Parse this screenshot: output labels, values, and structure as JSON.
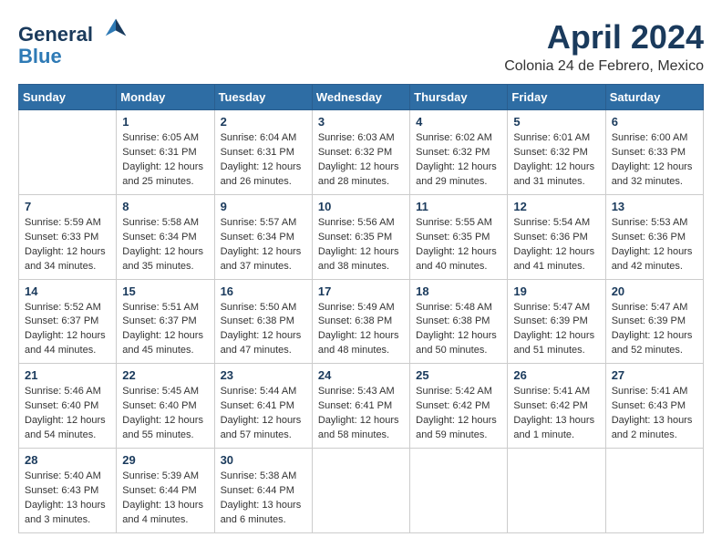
{
  "header": {
    "logo_line1": "General",
    "logo_line2": "Blue",
    "month_title": "April 2024",
    "subtitle": "Colonia 24 de Febrero, Mexico"
  },
  "weekdays": [
    "Sunday",
    "Monday",
    "Tuesday",
    "Wednesday",
    "Thursday",
    "Friday",
    "Saturday"
  ],
  "weeks": [
    [
      {
        "day": "",
        "info": ""
      },
      {
        "day": "1",
        "info": "Sunrise: 6:05 AM\nSunset: 6:31 PM\nDaylight: 12 hours\nand 25 minutes."
      },
      {
        "day": "2",
        "info": "Sunrise: 6:04 AM\nSunset: 6:31 PM\nDaylight: 12 hours\nand 26 minutes."
      },
      {
        "day": "3",
        "info": "Sunrise: 6:03 AM\nSunset: 6:32 PM\nDaylight: 12 hours\nand 28 minutes."
      },
      {
        "day": "4",
        "info": "Sunrise: 6:02 AM\nSunset: 6:32 PM\nDaylight: 12 hours\nand 29 minutes."
      },
      {
        "day": "5",
        "info": "Sunrise: 6:01 AM\nSunset: 6:32 PM\nDaylight: 12 hours\nand 31 minutes."
      },
      {
        "day": "6",
        "info": "Sunrise: 6:00 AM\nSunset: 6:33 PM\nDaylight: 12 hours\nand 32 minutes."
      }
    ],
    [
      {
        "day": "7",
        "info": "Sunrise: 5:59 AM\nSunset: 6:33 PM\nDaylight: 12 hours\nand 34 minutes."
      },
      {
        "day": "8",
        "info": "Sunrise: 5:58 AM\nSunset: 6:34 PM\nDaylight: 12 hours\nand 35 minutes."
      },
      {
        "day": "9",
        "info": "Sunrise: 5:57 AM\nSunset: 6:34 PM\nDaylight: 12 hours\nand 37 minutes."
      },
      {
        "day": "10",
        "info": "Sunrise: 5:56 AM\nSunset: 6:35 PM\nDaylight: 12 hours\nand 38 minutes."
      },
      {
        "day": "11",
        "info": "Sunrise: 5:55 AM\nSunset: 6:35 PM\nDaylight: 12 hours\nand 40 minutes."
      },
      {
        "day": "12",
        "info": "Sunrise: 5:54 AM\nSunset: 6:36 PM\nDaylight: 12 hours\nand 41 minutes."
      },
      {
        "day": "13",
        "info": "Sunrise: 5:53 AM\nSunset: 6:36 PM\nDaylight: 12 hours\nand 42 minutes."
      }
    ],
    [
      {
        "day": "14",
        "info": "Sunrise: 5:52 AM\nSunset: 6:37 PM\nDaylight: 12 hours\nand 44 minutes."
      },
      {
        "day": "15",
        "info": "Sunrise: 5:51 AM\nSunset: 6:37 PM\nDaylight: 12 hours\nand 45 minutes."
      },
      {
        "day": "16",
        "info": "Sunrise: 5:50 AM\nSunset: 6:38 PM\nDaylight: 12 hours\nand 47 minutes."
      },
      {
        "day": "17",
        "info": "Sunrise: 5:49 AM\nSunset: 6:38 PM\nDaylight: 12 hours\nand 48 minutes."
      },
      {
        "day": "18",
        "info": "Sunrise: 5:48 AM\nSunset: 6:38 PM\nDaylight: 12 hours\nand 50 minutes."
      },
      {
        "day": "19",
        "info": "Sunrise: 5:47 AM\nSunset: 6:39 PM\nDaylight: 12 hours\nand 51 minutes."
      },
      {
        "day": "20",
        "info": "Sunrise: 5:47 AM\nSunset: 6:39 PM\nDaylight: 12 hours\nand 52 minutes."
      }
    ],
    [
      {
        "day": "21",
        "info": "Sunrise: 5:46 AM\nSunset: 6:40 PM\nDaylight: 12 hours\nand 54 minutes."
      },
      {
        "day": "22",
        "info": "Sunrise: 5:45 AM\nSunset: 6:40 PM\nDaylight: 12 hours\nand 55 minutes."
      },
      {
        "day": "23",
        "info": "Sunrise: 5:44 AM\nSunset: 6:41 PM\nDaylight: 12 hours\nand 57 minutes."
      },
      {
        "day": "24",
        "info": "Sunrise: 5:43 AM\nSunset: 6:41 PM\nDaylight: 12 hours\nand 58 minutes."
      },
      {
        "day": "25",
        "info": "Sunrise: 5:42 AM\nSunset: 6:42 PM\nDaylight: 12 hours\nand 59 minutes."
      },
      {
        "day": "26",
        "info": "Sunrise: 5:41 AM\nSunset: 6:42 PM\nDaylight: 13 hours\nand 1 minute."
      },
      {
        "day": "27",
        "info": "Sunrise: 5:41 AM\nSunset: 6:43 PM\nDaylight: 13 hours\nand 2 minutes."
      }
    ],
    [
      {
        "day": "28",
        "info": "Sunrise: 5:40 AM\nSunset: 6:43 PM\nDaylight: 13 hours\nand 3 minutes."
      },
      {
        "day": "29",
        "info": "Sunrise: 5:39 AM\nSunset: 6:44 PM\nDaylight: 13 hours\nand 4 minutes."
      },
      {
        "day": "30",
        "info": "Sunrise: 5:38 AM\nSunset: 6:44 PM\nDaylight: 13 hours\nand 6 minutes."
      },
      {
        "day": "",
        "info": ""
      },
      {
        "day": "",
        "info": ""
      },
      {
        "day": "",
        "info": ""
      },
      {
        "day": "",
        "info": ""
      }
    ]
  ]
}
